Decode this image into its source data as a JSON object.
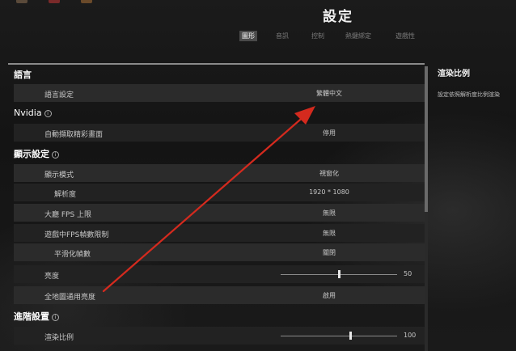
{
  "header": {
    "title": "設定",
    "tabs": [
      {
        "label": "圖形",
        "active": true
      },
      {
        "label": "音訊",
        "active": false
      },
      {
        "label": "控制",
        "active": false
      },
      {
        "label": "熱鍵綁定",
        "active": false
      },
      {
        "label": "遊戲性",
        "active": false
      }
    ]
  },
  "sections": {
    "language": {
      "title": "語言",
      "rows": {
        "language_setting": {
          "label": "語言設定",
          "value": "繁體中文"
        }
      }
    },
    "nvidia": {
      "title": "Nvidia",
      "rows": {
        "auto_capture": {
          "label": "自動擷取精彩畫面",
          "value": "停用"
        }
      }
    },
    "display": {
      "title": "顯示設定",
      "rows": {
        "display_mode": {
          "label": "顯示模式",
          "value": "視窗化"
        },
        "resolution": {
          "label": "解析度",
          "value": "1920 * 1080"
        },
        "lobby_fps": {
          "label": "大廳 FPS 上限",
          "value": "無限"
        },
        "ingame_fps": {
          "label": "遊戲中FPS幀數限制",
          "value": "無限"
        },
        "smooth_frames": {
          "label": "平滑化幀數",
          "value": "關閉"
        },
        "brightness": {
          "label": "亮度",
          "value": "50",
          "level": 0.5
        },
        "map_brightness": {
          "label": "全地圖通用亮度",
          "value": "啟用"
        }
      }
    },
    "advanced": {
      "title": "進階設置",
      "rows": {
        "render_scale": {
          "label": "渲染比例",
          "value": "100",
          "level": 0.6
        }
      }
    }
  },
  "info_panel": {
    "title": "渲染比例",
    "description": "設定依照解析度比例渲染"
  },
  "colors": {
    "background": "#191919",
    "row": "#2b2b2b",
    "row_alt": "#222222",
    "accent_text": "#ffffff",
    "annotation_arrow": "#d42a1e"
  }
}
